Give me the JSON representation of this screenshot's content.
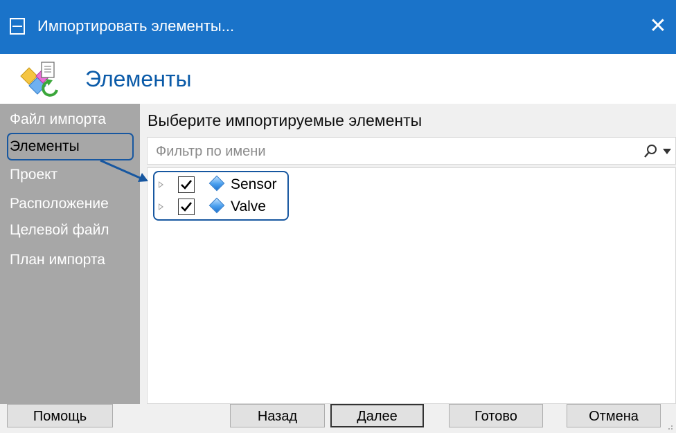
{
  "window": {
    "title": "Импортировать элементы...",
    "close_glyph": "✕"
  },
  "header": {
    "title": "Элементы",
    "icon": "import-elements-icon"
  },
  "sidebar": {
    "items": [
      {
        "label": "Файл импорта",
        "active": false
      },
      {
        "label": "Элементы",
        "active": true
      },
      {
        "label": "Проект",
        "active": false
      },
      {
        "label": "Расположение",
        "active": false
      },
      {
        "label": "Целевой файл",
        "active": false
      },
      {
        "label": "План импорта",
        "active": false
      }
    ]
  },
  "main": {
    "prompt": "Выберите импортируемые элементы",
    "filter": {
      "placeholder": "Фильтр по имени",
      "value": ""
    },
    "tree": [
      {
        "label": "Sensor",
        "checked": true,
        "expanded": false
      },
      {
        "label": "Valve",
        "checked": true,
        "expanded": false
      }
    ]
  },
  "footer": {
    "help": "Помощь",
    "back": "Назад",
    "next": "Далее",
    "finish": "Готово",
    "cancel": "Отмена"
  },
  "colors": {
    "titlebar": "#1a73c9",
    "sidebar": "#a7a7a7",
    "accent": "#0a5aa8",
    "annotation": "#1757a0"
  }
}
